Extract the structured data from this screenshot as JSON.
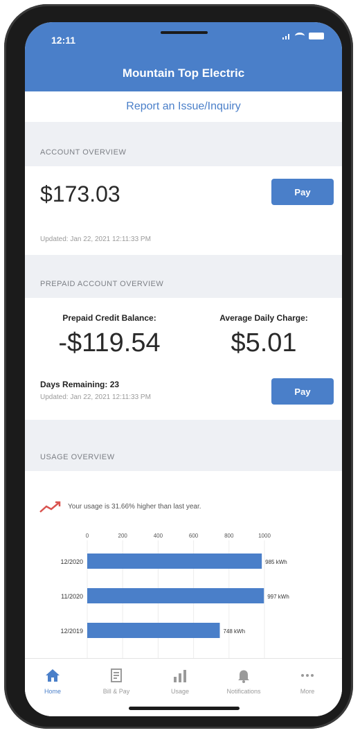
{
  "status": {
    "time": "12:11"
  },
  "header": {
    "title": "Mountain Top Electric"
  },
  "report_link": "Report an Issue/Inquiry",
  "account_overview": {
    "heading": "ACCOUNT OVERVIEW",
    "amount": "$173.03",
    "pay_label": "Pay",
    "updated": "Updated: Jan 22, 2021 12:11:33 PM"
  },
  "prepaid_overview": {
    "heading": "PREPAID ACCOUNT OVERVIEW",
    "credit_label": "Prepaid Credit Balance:",
    "credit_value": "-$119.54",
    "avg_label": "Average Daily Charge:",
    "avg_value": "$5.01",
    "days_remaining": "Days Remaining: 23",
    "updated": "Updated: Jan 22, 2021 12:11:33 PM",
    "pay_label": "Pay"
  },
  "usage_overview": {
    "heading": "USAGE OVERVIEW",
    "note": "Your usage is 31.66% higher than last year."
  },
  "chart_data": {
    "type": "bar",
    "orientation": "horizontal",
    "categories": [
      "12/2020",
      "11/2020",
      "12/2019"
    ],
    "values": [
      985,
      997,
      748
    ],
    "value_labels": [
      "985 kWh",
      "997 kWh",
      "748 kWh"
    ],
    "ticks": [
      0,
      200,
      400,
      600,
      800,
      1000
    ],
    "xlim": [
      0,
      1000
    ],
    "color": "#4a7fc9"
  },
  "tabs": [
    {
      "label": "Home",
      "icon": "home-icon",
      "active": true
    },
    {
      "label": "Bill & Pay",
      "icon": "bill-icon",
      "active": false
    },
    {
      "label": "Usage",
      "icon": "usage-chart-icon",
      "active": false
    },
    {
      "label": "Notifications",
      "icon": "bell-icon",
      "active": false
    },
    {
      "label": "More",
      "icon": "more-icon",
      "active": false
    }
  ],
  "colors": {
    "brand": "#4a7fc9",
    "trend": "#d9534f"
  }
}
